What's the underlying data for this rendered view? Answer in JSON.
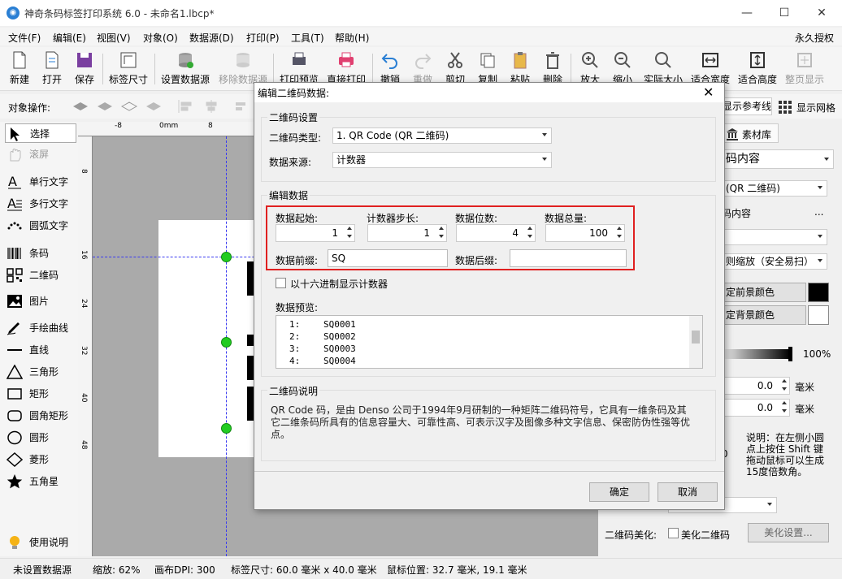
{
  "window": {
    "title": "神奇条码标签打印系统 6.0 - 未命名1.lbcp*",
    "minimize": "—",
    "maximize": "☐",
    "close": "✕"
  },
  "menu": {
    "items": [
      "文件(F)",
      "编辑(E)",
      "视图(V)",
      "对象(O)",
      "数据源(D)",
      "打印(P)",
      "工具(T)",
      "帮助(H)"
    ],
    "right": "永久授权"
  },
  "toolbar": {
    "items": [
      "新建",
      "打开",
      "保存",
      "标签尺寸",
      "设置数据源",
      "移除数据源",
      "打印预览",
      "直接打印",
      "撤销",
      "重做",
      "剪切",
      "复制",
      "粘贴",
      "删除",
      "放大",
      "缩小",
      "实际大小",
      "适合宽度",
      "适合高度",
      "整页显示"
    ]
  },
  "objbar": {
    "label": "对象操作:",
    "show_guides": "显示参考线",
    "show_grid": "显示网格"
  },
  "lefttools": {
    "items": [
      "选择",
      "滚屏",
      "单行文字",
      "多行文字",
      "圆弧文字",
      "条码",
      "二维码",
      "图片",
      "手绘曲线",
      "直线",
      "三角形",
      "矩形",
      "圆角矩形",
      "圆形",
      "菱形",
      "五角星",
      "使用说明"
    ]
  },
  "ruler": {
    "top": [
      "-8",
      "0mm",
      "8"
    ],
    "left": [
      "0",
      "8",
      "16",
      "24",
      "32",
      "40",
      "48"
    ]
  },
  "rightpanel": {
    "tab_library": "素材库",
    "content_combo": "码内容",
    "type_combo": "(QR 二维码)",
    "content_label": "码内容",
    "more_btn": "...",
    "scale_combo": "则缩放（安全易扫）",
    "fg_label": "定前景颜色",
    "bg_label": "定背景颜色",
    "opacity": "100%",
    "val1": "0.0",
    "val2": "0.0",
    "unit1": "毫米",
    "unit2": "毫米",
    "zero_text": "0",
    "note": "说明：在左侧小圆点上按住 Shift 键拖动鼠标可以生成15度倍数角。",
    "beautify_label": "二维码美化:",
    "beautify_check": "美化二维码",
    "beautify_btn": "美化设置..."
  },
  "statusbar": {
    "datasource": "未设置数据源",
    "zoom": "缩放: 62%",
    "dpi": "画布DPI: 300",
    "size": "标签尺寸: 60.0 毫米 x 40.0 毫米",
    "pos": "鼠标位置: 32.7 毫米, 19.1 毫米"
  },
  "dialog": {
    "title": "编辑二维码数据:",
    "close": "✕",
    "settings_group": "二维码设置",
    "type_label": "二维码类型:",
    "type_value": "1. QR Code (QR 二维码)",
    "source_label": "数据来源:",
    "source_value": "计数器",
    "edit_group": "编辑数据",
    "start_label": "数据起始:",
    "step_label": "计数器步长:",
    "digits_label": "数据位数:",
    "total_label": "数据总量:",
    "start_value": "1",
    "step_value": "1",
    "digits_value": "4",
    "total_value": "100",
    "prefix_label": "数据前缀:",
    "prefix_value": "SQ",
    "suffix_label": "数据后缀:",
    "suffix_value": "",
    "hex_label": "以十六进制显示计数器",
    "preview_label": "数据预览:",
    "preview_rows": [
      {
        "idx": "1:",
        "val": "SQ0001"
      },
      {
        "idx": "2:",
        "val": "SQ0002"
      },
      {
        "idx": "3:",
        "val": "SQ0003"
      },
      {
        "idx": "4:",
        "val": "SQ0004"
      }
    ],
    "desc_group": "二维码说明",
    "desc_text": "QR Code 码，是由 Denso 公司于1994年9月研制的一种矩阵二维码符号，它具有一维条码及其它二维条码所具有的信息容量大、可靠性高、可表示汉字及图像多种文字信息、保密防伪性强等优点。",
    "ok": "确定",
    "cancel": "取消"
  },
  "colors": {
    "highlight_border": "#e02020",
    "guide_line": "#3a3af0",
    "handle": "#22cc22"
  }
}
